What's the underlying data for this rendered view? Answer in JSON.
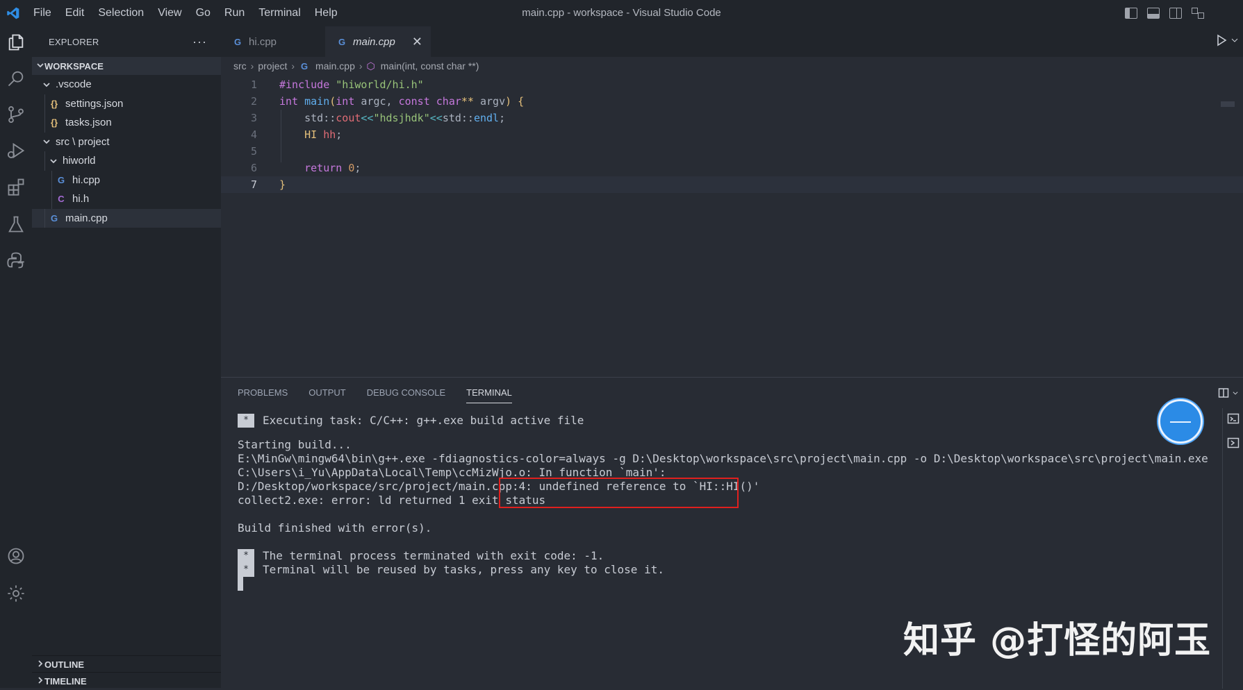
{
  "window": {
    "title": "main.cpp - workspace - Visual Studio Code",
    "menu": [
      "File",
      "Edit",
      "Selection",
      "View",
      "Go",
      "Run",
      "Terminal",
      "Help"
    ]
  },
  "sidebar": {
    "title": "EXPLORER",
    "more": "···",
    "workspace": "WORKSPACE",
    "tree": [
      {
        "label": ".vscode",
        "type": "folder",
        "depth": 1
      },
      {
        "label": "settings.json",
        "type": "json",
        "icon": "{}",
        "depth": 2
      },
      {
        "label": "tasks.json",
        "type": "json",
        "icon": "{}",
        "depth": 2
      },
      {
        "label": "src \\ project",
        "type": "folder",
        "depth": 1
      },
      {
        "label": "hiworld",
        "type": "folder",
        "depth": 2
      },
      {
        "label": "hi.cpp",
        "type": "cpp",
        "icon": "G",
        "depth": 3
      },
      {
        "label": "hi.h",
        "type": "h",
        "icon": "C",
        "depth": 3
      },
      {
        "label": "main.cpp",
        "type": "cpp",
        "icon": "G",
        "depth": 2,
        "selected": true
      }
    ],
    "outline": "OUTLINE",
    "timeline": "TIMELINE"
  },
  "editor": {
    "tabs": [
      {
        "label": "hi.cpp",
        "icon": "G",
        "active": false
      },
      {
        "label": "main.cpp",
        "icon": "G",
        "active": true,
        "close": "✕"
      }
    ],
    "breadcrumb": [
      "src",
      "project",
      "main.cpp",
      "main(int, const char **)"
    ],
    "lines": [
      {
        "n": "1",
        "tokens": [
          [
            "t-kw",
            "#include "
          ],
          [
            "t-str",
            "\"hiworld/hi.h\""
          ]
        ]
      },
      {
        "n": "2",
        "tokens": [
          [
            "t-kw",
            "int "
          ],
          [
            "t-fn",
            "main"
          ],
          [
            "t-brace",
            "("
          ],
          [
            "t-kw",
            "int "
          ],
          [
            "t-plain",
            "argc, "
          ],
          [
            "t-kw",
            "const char"
          ],
          [
            "t-type",
            "** "
          ],
          [
            "t-plain",
            "argv"
          ],
          [
            "t-brace",
            ") {"
          ]
        ]
      },
      {
        "n": "3",
        "tokens": [
          [
            "t-plain",
            "    std::"
          ],
          [
            "t-var",
            "cout"
          ],
          [
            "t-op",
            "<<"
          ],
          [
            "t-str",
            "\"hdsjhdk\""
          ],
          [
            "t-op",
            "<<"
          ],
          [
            "t-plain",
            "std::"
          ],
          [
            "t-fn",
            "endl"
          ],
          [
            "t-plain",
            ";"
          ]
        ]
      },
      {
        "n": "4",
        "tokens": [
          [
            "t-plain",
            "    "
          ],
          [
            "t-type",
            "HI "
          ],
          [
            "t-var",
            "hh"
          ],
          [
            "t-plain",
            ";"
          ]
        ]
      },
      {
        "n": "5",
        "tokens": []
      },
      {
        "n": "6",
        "tokens": [
          [
            "t-plain",
            "    "
          ],
          [
            "t-kw",
            "return "
          ],
          [
            "t-num",
            "0"
          ],
          [
            "t-plain",
            ";"
          ]
        ]
      },
      {
        "n": "7",
        "tokens": [
          [
            "t-brace",
            "}"
          ]
        ],
        "current": true
      }
    ]
  },
  "panel": {
    "tabs": [
      "PROBLEMS",
      "OUTPUT",
      "DEBUG CONSOLE",
      "TERMINAL"
    ],
    "active_tab": "TERMINAL",
    "terminal": [
      {
        "marker": "*",
        "text": "Executing task: C/C++: g++.exe build active file"
      },
      {
        "text": ""
      },
      {
        "text": "Starting build..."
      },
      {
        "text": "E:\\MinGw\\mingw64\\bin\\g++.exe -fdiagnostics-color=always -g D:\\Desktop\\workspace\\src\\project\\main.cpp -o D:\\Desktop\\workspace\\src\\project\\main.exe"
      },
      {
        "text": "C:\\Users\\i_Yu\\AppData\\Local\\Temp\\ccMizWjo.o: In function `main':"
      },
      {
        "text": "D:/Desktop/workspace/src/project/main.cpp:4: undefined reference to `HI::HI()'"
      },
      {
        "text": "collect2.exe: error: ld returned 1 exit status"
      },
      {
        "text": ""
      },
      {
        "text": "Build finished with error(s)."
      },
      {
        "text": ""
      },
      {
        "marker": "*",
        "text": "The terminal process terminated with exit code: -1."
      },
      {
        "marker": "*",
        "text": "Terminal will be reused by tasks, press any key to close it."
      },
      {
        "marker": " ",
        "thin": true,
        "text": ""
      }
    ]
  },
  "watermark": "知乎 @打怪的阿玉",
  "colors": {
    "accent": "#61afef",
    "error_box": "#e0201e"
  }
}
